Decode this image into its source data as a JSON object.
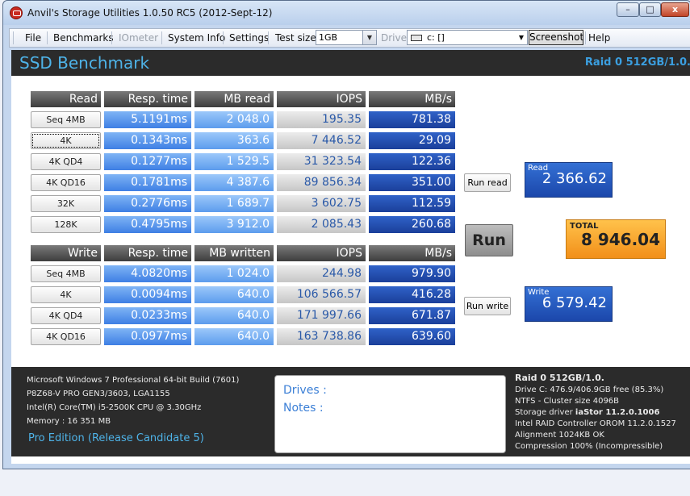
{
  "window": {
    "title": "Anvil's Storage Utilities 1.0.50 RC5 (2012-Sept-12)",
    "min_label": "–",
    "max_label": "□",
    "close_label": "x"
  },
  "menu": {
    "file": "File",
    "benchmarks": "Benchmarks",
    "iometer": "IOmeter",
    "system_info": "System Info",
    "settings": "Settings",
    "test_size_label": "Test size",
    "test_size_value": "1GB",
    "drive_label": "Drive",
    "drive_value": "c: []",
    "screenshot": "Screenshot",
    "help": "Help"
  },
  "header": {
    "title": "SSD Benchmark",
    "raid_title": "Raid 0 512GB/1.0."
  },
  "read_table": {
    "headers": [
      "Read",
      "Resp. time",
      "MB read",
      "IOPS",
      "MB/s"
    ],
    "rows": [
      {
        "label": "Seq 4MB",
        "resp": "5.1191ms",
        "mb": "2 048.0",
        "iops": "195.35",
        "mbs": "781.38"
      },
      {
        "label": "4K",
        "resp": "0.1343ms",
        "mb": "363.6",
        "iops": "7 446.52",
        "mbs": "29.09"
      },
      {
        "label": "4K QD4",
        "resp": "0.1277ms",
        "mb": "1 529.5",
        "iops": "31 323.54",
        "mbs": "122.36"
      },
      {
        "label": "4K QD16",
        "resp": "0.1781ms",
        "mb": "4 387.6",
        "iops": "89 856.34",
        "mbs": "351.00"
      },
      {
        "label": "32K",
        "resp": "0.2776ms",
        "mb": "1 689.7",
        "iops": "3 602.75",
        "mbs": "112.59"
      },
      {
        "label": "128K",
        "resp": "0.4795ms",
        "mb": "3 912.0",
        "iops": "2 085.43",
        "mbs": "260.68"
      }
    ]
  },
  "write_table": {
    "headers": [
      "Write",
      "Resp. time",
      "MB written",
      "IOPS",
      "MB/s"
    ],
    "rows": [
      {
        "label": "Seq 4MB",
        "resp": "4.0820ms",
        "mb": "1 024.0",
        "iops": "244.98",
        "mbs": "979.90"
      },
      {
        "label": "4K",
        "resp": "0.0094ms",
        "mb": "640.0",
        "iops": "106 566.57",
        "mbs": "416.28"
      },
      {
        "label": "4K QD4",
        "resp": "0.0233ms",
        "mb": "640.0",
        "iops": "171 997.66",
        "mbs": "671.87"
      },
      {
        "label": "4K QD16",
        "resp": "0.0977ms",
        "mb": "640.0",
        "iops": "163 738.86",
        "mbs": "639.60"
      }
    ]
  },
  "controls": {
    "run_read": "Run read",
    "run": "Run",
    "run_write": "Run write"
  },
  "scores": {
    "read_label": "Read",
    "read_value": "2 366.62",
    "total_label": "TOTAL",
    "total_value": "8 946.04",
    "write_label": "Write",
    "write_value": "6 579.42"
  },
  "system": {
    "os": "Microsoft Windows 7 Professional  64-bit Build (7601)",
    "board": "P8Z68-V PRO GEN3/3603, LGA1155",
    "cpu": "Intel(R) Core(TM) i5-2500K CPU @ 3.30GHz",
    "memory": "Memory : 16 351 MB",
    "edition": "Pro Edition (Release Candidate 5)"
  },
  "notes": {
    "drives_label": "Drives :",
    "notes_label": "Notes :"
  },
  "raid_info": {
    "title": "Raid 0 512GB/1.0.",
    "drive_c": "Drive C: 476.9/406.9GB free (85.3%)",
    "ntfs": "NTFS - Cluster size 4096B",
    "storage_driver_label": "Storage driver ",
    "storage_driver_value": "iaStor 11.2.0.1006",
    "controller": "Intel RAID Controller OROM 11.2.0.1527",
    "alignment": "Alignment 1024KB OK",
    "compression": "Compression 100% (Incompressible)"
  },
  "colors": {
    "header_bg": "#2b2b2b",
    "accent_blue": "#4eb3e8",
    "total_orange": "#f7a431"
  }
}
